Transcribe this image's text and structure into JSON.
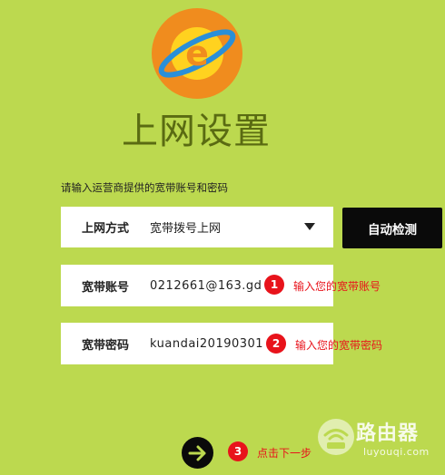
{
  "title": "上网设置",
  "instruction": "请输入运营商提供的宽带账号和密码",
  "form": {
    "mode": {
      "label": "上网方式",
      "value": "宽带拨号上网"
    },
    "account": {
      "label": "宽带账号",
      "value": "0212661@163.gd"
    },
    "password": {
      "label": "宽带密码",
      "value": "kuandai20190301"
    }
  },
  "detect_button": "自动检测",
  "steps": [
    {
      "num": "1",
      "text": "输入您的宽带账号"
    },
    {
      "num": "2",
      "text": "输入您的宽带密码"
    },
    {
      "num": "3",
      "text": "点击下一步"
    }
  ],
  "watermark": {
    "name": "路由器",
    "url": "luyouqi.com"
  },
  "colors": {
    "background": "#bcd94f",
    "title": "#5a6b12",
    "badge": "#e8131b",
    "button": "#0a0a0a",
    "logo_orange": "#f08c1e",
    "logo_yellow": "#ffd21f",
    "logo_blue": "#2a8fd8"
  },
  "icons": {
    "logo": "ie-style-globe-logo",
    "next": "arrow-right-icon",
    "dropdown": "caret-down-icon",
    "watermark": "router-wifi-icon"
  }
}
